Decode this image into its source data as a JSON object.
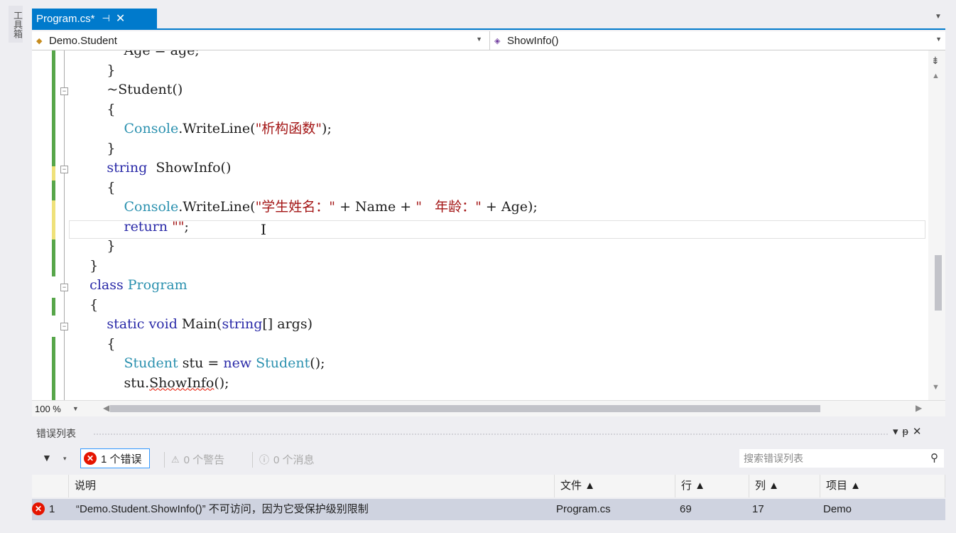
{
  "toolbox": {
    "label": "工具箱"
  },
  "tab": {
    "title": "Program.cs*",
    "pin": "⊣",
    "close": "✕"
  },
  "nav": {
    "left": "Demo.Student",
    "right": "ShowInfo()"
  },
  "editor": {
    "lines": [
      {
        "indent": "            ",
        "parts": [
          {
            "t": "Age = age;",
            "c": ""
          }
        ]
      },
      {
        "indent": "        ",
        "parts": [
          {
            "t": "}",
            "c": ""
          }
        ]
      },
      {
        "indent": "        ",
        "parts": [
          {
            "t": "~Student()",
            "c": ""
          }
        ]
      },
      {
        "indent": "        ",
        "parts": [
          {
            "t": "{",
            "c": ""
          }
        ]
      },
      {
        "indent": "            ",
        "parts": [
          {
            "t": "Console",
            "c": "ty"
          },
          {
            "t": ".WriteLine(",
            "c": ""
          },
          {
            "t": "\"析构函数\"",
            "c": "st"
          },
          {
            "t": ");",
            "c": ""
          }
        ]
      },
      {
        "indent": "        ",
        "parts": [
          {
            "t": "}",
            "c": ""
          }
        ]
      },
      {
        "indent": "        ",
        "parts": [
          {
            "t": "string",
            "c": "kw"
          },
          {
            "t": "  ShowInfo()",
            "c": ""
          }
        ]
      },
      {
        "indent": "        ",
        "parts": [
          {
            "t": "{",
            "c": ""
          }
        ]
      },
      {
        "indent": "            ",
        "parts": [
          {
            "t": "Console",
            "c": "ty"
          },
          {
            "t": ".WriteLine(",
            "c": ""
          },
          {
            "t": "\"学生姓名：\"",
            "c": "st"
          },
          {
            "t": " + Name + ",
            "c": ""
          },
          {
            "t": "\"   年龄：\"",
            "c": "st"
          },
          {
            "t": " + Age);",
            "c": ""
          }
        ]
      },
      {
        "indent": "            ",
        "parts": [
          {
            "t": "return",
            "c": "kw"
          },
          {
            "t": " ",
            "c": ""
          },
          {
            "t": "\"\"",
            "c": "st"
          },
          {
            "t": ";",
            "c": ""
          }
        ]
      },
      {
        "indent": "        ",
        "parts": [
          {
            "t": "}",
            "c": ""
          }
        ]
      },
      {
        "indent": "    ",
        "parts": [
          {
            "t": "}",
            "c": ""
          }
        ]
      },
      {
        "indent": "    ",
        "parts": [
          {
            "t": "class",
            "c": "kw"
          },
          {
            "t": " ",
            "c": ""
          },
          {
            "t": "Program",
            "c": "ty"
          }
        ]
      },
      {
        "indent": "    ",
        "parts": [
          {
            "t": "{",
            "c": ""
          }
        ]
      },
      {
        "indent": "        ",
        "parts": [
          {
            "t": "static",
            "c": "kw"
          },
          {
            "t": " ",
            "c": ""
          },
          {
            "t": "void",
            "c": "kw"
          },
          {
            "t": " Main(",
            "c": ""
          },
          {
            "t": "string",
            "c": "kw"
          },
          {
            "t": "[] args)",
            "c": ""
          }
        ]
      },
      {
        "indent": "        ",
        "parts": [
          {
            "t": "{",
            "c": ""
          }
        ]
      },
      {
        "indent": "            ",
        "parts": [
          {
            "t": "Student",
            "c": "ty"
          },
          {
            "t": " stu = ",
            "c": ""
          },
          {
            "t": "new",
            "c": "kw"
          },
          {
            "t": " ",
            "c": ""
          },
          {
            "t": "Student",
            "c": "ty"
          },
          {
            "t": "();",
            "c": ""
          }
        ]
      },
      {
        "indent": "            ",
        "parts": [
          {
            "t": "stu.",
            "c": ""
          },
          {
            "t": "ShowInfo",
            "c": "squiggle"
          },
          {
            "t": "();",
            "c": ""
          }
        ]
      }
    ],
    "cursor_glyph": "I"
  },
  "zoom": {
    "value": "100 %"
  },
  "error_list": {
    "title": "错误列表",
    "errors_label": "1 个错误",
    "warnings_label": "0 个警告",
    "messages_label": "0 个消息",
    "search_placeholder": "搜索错误列表",
    "columns": {
      "desc": "说明",
      "file": "文件 ▲",
      "line": "行 ▲",
      "col": "列 ▲",
      "project": "项目 ▲"
    },
    "rows": [
      {
        "index": "1",
        "desc": "“Demo.Student.ShowInfo()” 不可访问，因为它受保护级别限制",
        "file": "Program.cs",
        "line": "69",
        "col": "17",
        "project": "Demo"
      }
    ]
  },
  "colors": {
    "accent": "#007acc",
    "keyword": "#2a2aa8",
    "type": "#2b91af",
    "string": "#a31515",
    "error": "#e51400"
  }
}
